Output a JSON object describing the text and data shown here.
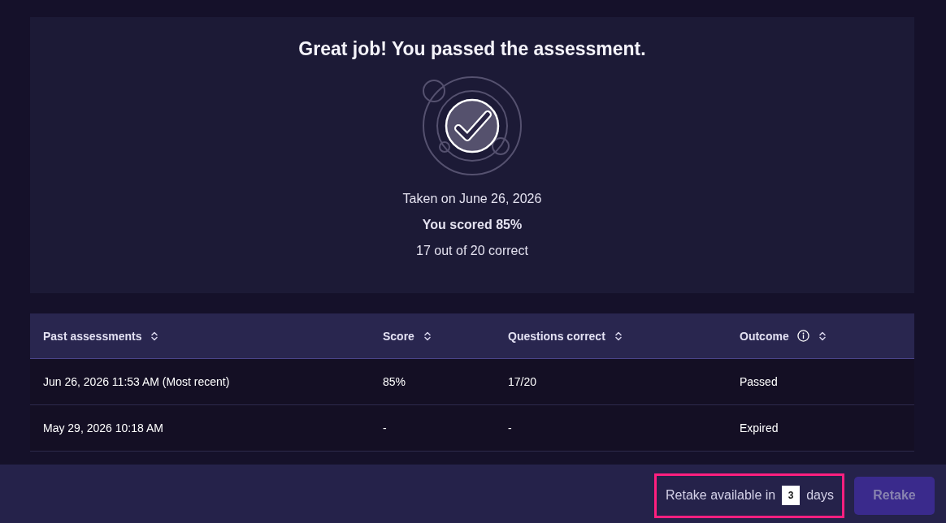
{
  "result": {
    "heading": "Great job! You passed the assessment.",
    "taken_on": "Taken on June 26, 2026",
    "score": "You scored 85%",
    "correct": "17 out of 20 correct"
  },
  "table": {
    "columns": [
      {
        "label": "Past assessments",
        "sortable": true,
        "info": false
      },
      {
        "label": "Score",
        "sortable": true,
        "info": false
      },
      {
        "label": "Questions correct",
        "sortable": true,
        "info": false
      },
      {
        "label": "Outcome",
        "sortable": true,
        "info": true
      }
    ],
    "rows": [
      {
        "cells": [
          "Jun 26, 2026 11:53 AM (Most recent)",
          "85%",
          "17/20",
          "Passed"
        ]
      },
      {
        "cells": [
          "May 29, 2026 10:18 AM",
          "-",
          "-",
          "Expired"
        ]
      }
    ]
  },
  "footer": {
    "retake_notice": {
      "prefix": "Retake available in",
      "days": "3",
      "suffix": "days",
      "highlighted": true
    },
    "retake_button": {
      "label": "Retake",
      "disabled": true
    }
  }
}
